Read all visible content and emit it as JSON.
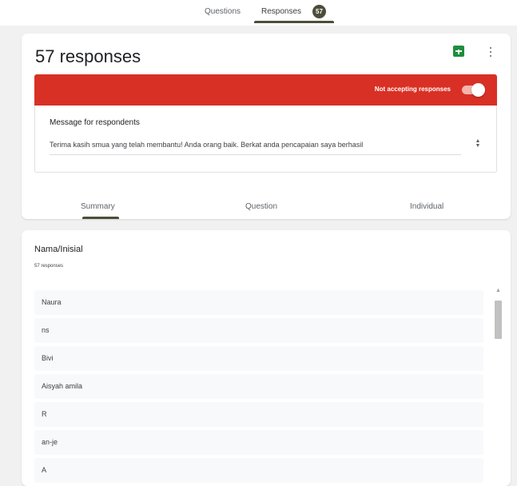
{
  "header": {
    "tabs": [
      {
        "label": "Questions"
      },
      {
        "label": "Responses"
      }
    ],
    "response_badge": "57"
  },
  "summary_card": {
    "title": "57 responses",
    "accepting_label": "Not accepting responses",
    "accepting": false,
    "message_label": "Message for respondents",
    "message_text": "Terima kasih smua yang telah membantu! Anda orang baik. Berkat anda pencapaian saya berhasil",
    "sub_tabs": [
      {
        "label": "Summary"
      },
      {
        "label": "Question"
      },
      {
        "label": "Individual"
      }
    ]
  },
  "question_card": {
    "title": "Nama/Inisial",
    "count": "57 responses",
    "answers": [
      "Naura",
      "ns",
      "Bivi",
      "Aisyah amila",
      "R",
      "an-je",
      "A"
    ]
  },
  "colors": {
    "banner": "#d93025",
    "sheets": "#1e8e3e",
    "accent": "#4d4d3a"
  },
  "icons": [
    "sheets-icon",
    "more-vert-icon",
    "toggle-switch",
    "spin-icon",
    "scroll-up-icon"
  ]
}
